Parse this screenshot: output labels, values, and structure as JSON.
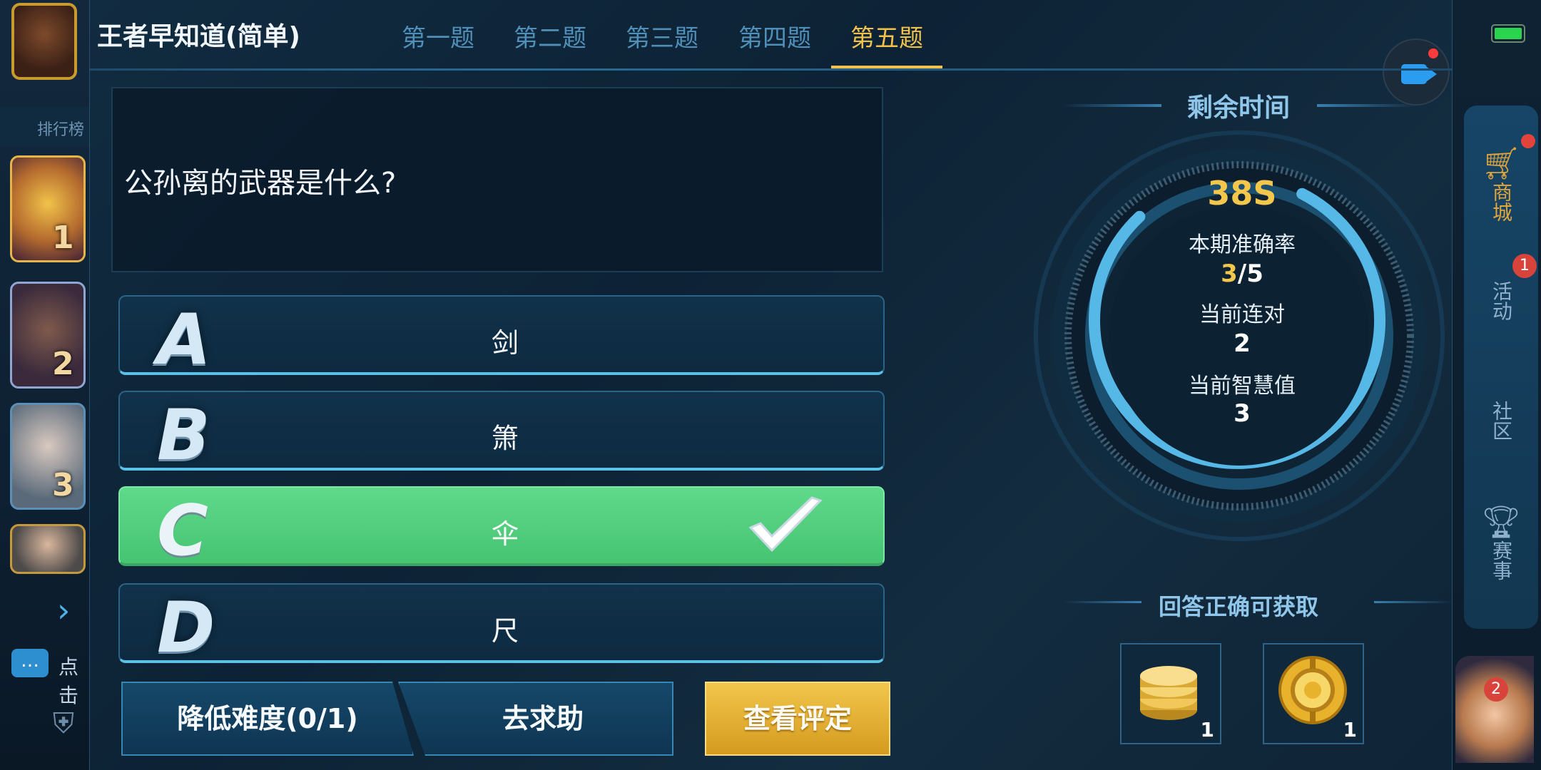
{
  "app": {
    "title": "王者早知道(简单)"
  },
  "tabs": [
    {
      "label": "第一题",
      "active": false
    },
    {
      "label": "第二题",
      "active": false
    },
    {
      "label": "第三题",
      "active": false
    },
    {
      "label": "第四题",
      "active": false
    },
    {
      "label": "第五题",
      "active": true
    }
  ],
  "question": {
    "text": "公孙离的武器是什么?"
  },
  "options": [
    {
      "letter": "A",
      "text": "剑",
      "correct": false
    },
    {
      "letter": "B",
      "text": "箫",
      "correct": false
    },
    {
      "letter": "C",
      "text": "伞",
      "correct": true
    },
    {
      "letter": "D",
      "text": "尺",
      "correct": false
    }
  ],
  "buttons": {
    "lower_difficulty": "降低难度(0/1)",
    "ask_help": "去求助",
    "view_rating": "查看评定"
  },
  "timer": {
    "title": "剩余时间",
    "remaining": "38S",
    "accuracy_label": "本期准确率",
    "accuracy_correct": "3",
    "accuracy_total": "/5",
    "streak_label": "当前连对",
    "streak_value": "2",
    "wisdom_label": "当前智慧值",
    "wisdom_value": "3"
  },
  "reward": {
    "title": "回答正确可获取",
    "items": [
      {
        "icon": "coin-stack-icon",
        "count": "1"
      },
      {
        "icon": "gold-medal-icon",
        "count": "1"
      }
    ]
  },
  "background": {
    "left_rank_label": "排行榜",
    "rank_numbers": [
      "1",
      "2",
      "3"
    ],
    "chat_placeholder": "点击",
    "side_menu": [
      "商城",
      "活动",
      "社区",
      "赛事"
    ],
    "events_badge": "1",
    "hero_badge": "2"
  },
  "colors": {
    "accent_gold": "#f0c14c",
    "correct_green": "#4fcf7d",
    "option_border": "#5cc1e6",
    "tab_inactive": "#4f8fb8"
  }
}
